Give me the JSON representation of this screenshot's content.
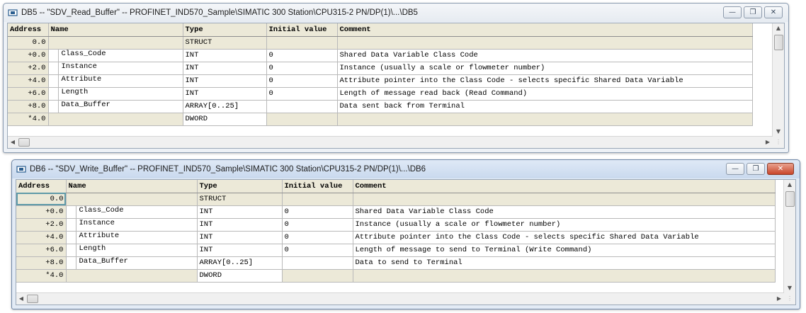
{
  "colors": {
    "accent": "#c8452a",
    "header_bg": "#ece9d8"
  },
  "columns": [
    "Address",
    "Name",
    "Type",
    "Initial value",
    "Comment"
  ],
  "windows": [
    {
      "title": "DB5 -- \"SDV_Read_Buffer\" -- PROFINET_IND570_Sample\\SIMATIC 300 Station\\CPU315-2 PN/DP(1)\\...\\DB5",
      "rows": [
        {
          "address": "0.0",
          "name": "",
          "type": "STRUCT",
          "initial": "",
          "comment": ""
        },
        {
          "address": "+0.0",
          "name": "Class_Code",
          "type": "INT",
          "initial": "0",
          "comment": "Shared Data Variable Class Code"
        },
        {
          "address": "+2.0",
          "name": "Instance",
          "type": "INT",
          "initial": "0",
          "comment": "Instance (usually a scale or flowmeter number)"
        },
        {
          "address": "+4.0",
          "name": "Attribute",
          "type": "INT",
          "initial": "0",
          "comment": "Attribute pointer into the Class Code - selects specific Shared Data Variable"
        },
        {
          "address": "+6.0",
          "name": "Length",
          "type": "INT",
          "initial": "0",
          "comment": "Length of message read back (Read Command)"
        },
        {
          "address": "+8.0",
          "name": "Data_Buffer",
          "type": "ARRAY[0..25]",
          "initial": "",
          "comment": "Data sent back from Terminal"
        },
        {
          "address": "*4.0",
          "name": "",
          "type": "DWORD",
          "initial": "",
          "comment": ""
        }
      ]
    },
    {
      "title": "DB6 -- \"SDV_Write_Buffer\" -- PROFINET_IND570_Sample\\SIMATIC 300 Station\\CPU315-2 PN/DP(1)\\...\\DB6",
      "rows": [
        {
          "address": "0.0",
          "name": "",
          "type": "STRUCT",
          "initial": "",
          "comment": ""
        },
        {
          "address": "+0.0",
          "name": "Class_Code",
          "type": "INT",
          "initial": "0",
          "comment": "Shared Data Variable Class Code"
        },
        {
          "address": "+2.0",
          "name": "Instance",
          "type": "INT",
          "initial": "0",
          "comment": "Instance (usually a scale or flowmeter number)"
        },
        {
          "address": "+4.0",
          "name": "Attribute",
          "type": "INT",
          "initial": "0",
          "comment": "Attribute pointer into the Class Code - selects specific Shared Data Variable"
        },
        {
          "address": "+6.0",
          "name": "Length",
          "type": "INT",
          "initial": "0",
          "comment": "Length of message to send to Terminal (Write Command)"
        },
        {
          "address": "+8.0",
          "name": "Data_Buffer",
          "type": "ARRAY[0..25]",
          "initial": "",
          "comment": "Data to send to Terminal"
        },
        {
          "address": "*4.0",
          "name": "",
          "type": "DWORD",
          "initial": "",
          "comment": ""
        }
      ]
    }
  ]
}
